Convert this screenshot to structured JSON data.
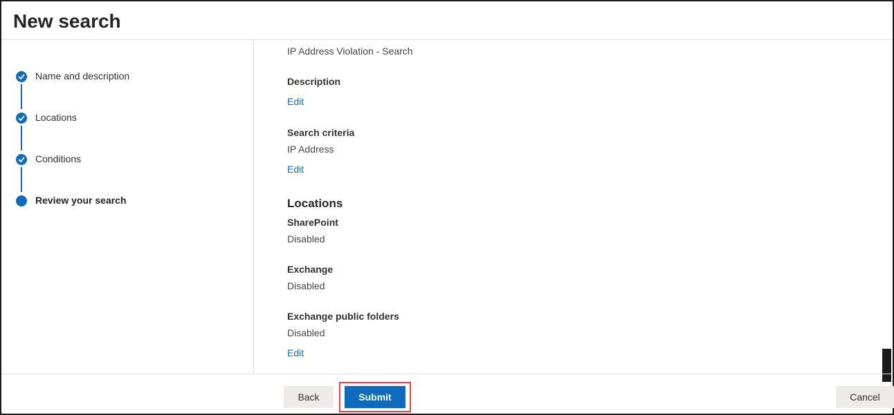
{
  "header": {
    "title": "New search"
  },
  "stepper": {
    "steps": [
      {
        "label": "Name and description",
        "status": "completed"
      },
      {
        "label": "Locations",
        "status": "completed"
      },
      {
        "label": "Conditions",
        "status": "completed"
      },
      {
        "label": "Review your search",
        "status": "current"
      }
    ]
  },
  "review": {
    "name_value": "IP Address Violation - Search",
    "description_label": "Description",
    "description_edit": "Edit",
    "criteria_label": "Search criteria",
    "criteria_value": "IP Address",
    "criteria_edit": "Edit",
    "locations_heading": "Locations",
    "locations": [
      {
        "label": "SharePoint",
        "value": "Disabled"
      },
      {
        "label": "Exchange",
        "value": "Disabled"
      },
      {
        "label": "Exchange public folders",
        "value": "Disabled"
      }
    ],
    "locations_edit": "Edit"
  },
  "footer": {
    "back_label": "Back",
    "submit_label": "Submit",
    "cancel_label": "Cancel"
  },
  "colors": {
    "accent": "#0f6cbd",
    "highlight_outline": "#e0484e"
  }
}
